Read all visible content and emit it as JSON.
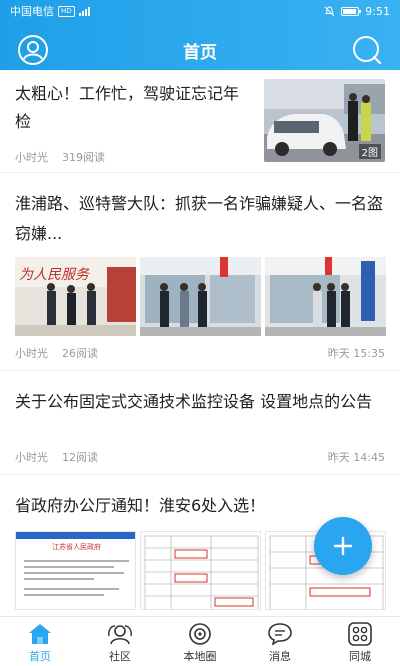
{
  "status_bar": {
    "carrier": "中国电信",
    "network_badge": "HD",
    "time": "9:51"
  },
  "header": {
    "title": "首页",
    "left_icon": "user-icon",
    "right_icon": "search-icon"
  },
  "articles": [
    {
      "title": "太粗心！工作忙，驾驶证忘记年检",
      "source": "小时光",
      "reads": "319阅读",
      "image_count": "2图"
    },
    {
      "title": "淮浦路、巡特警大队：抓获一名诈骗嫌疑人、一名盗窃嫌...",
      "source": "小时光",
      "reads": "26阅读",
      "time": "昨天 15:35"
    },
    {
      "title": "关于公布固定式交通技术监控设备 设置地点的公告",
      "source": "小时光",
      "reads": "12阅读",
      "time": "昨天 14:45"
    },
    {
      "title": "省政府办公厅通知！淮安6处入选！",
      "doc_heading": "江苏省人民政府"
    }
  ],
  "fab": {
    "icon": "plus-icon"
  },
  "bottom_nav": [
    {
      "label": "首页",
      "icon": "home-icon",
      "active": true
    },
    {
      "label": "社区",
      "icon": "community-icon",
      "active": false
    },
    {
      "label": "本地圈",
      "icon": "local-circle-icon",
      "active": false
    },
    {
      "label": "消息",
      "icon": "message-icon",
      "active": false
    },
    {
      "label": "同城",
      "icon": "grid-icon",
      "active": false
    }
  ],
  "colors": {
    "accent": "#2aa5ef",
    "header_start": "#1f9fe8",
    "header_end": "#39b2f2",
    "meta_text": "#9a9a9a"
  }
}
